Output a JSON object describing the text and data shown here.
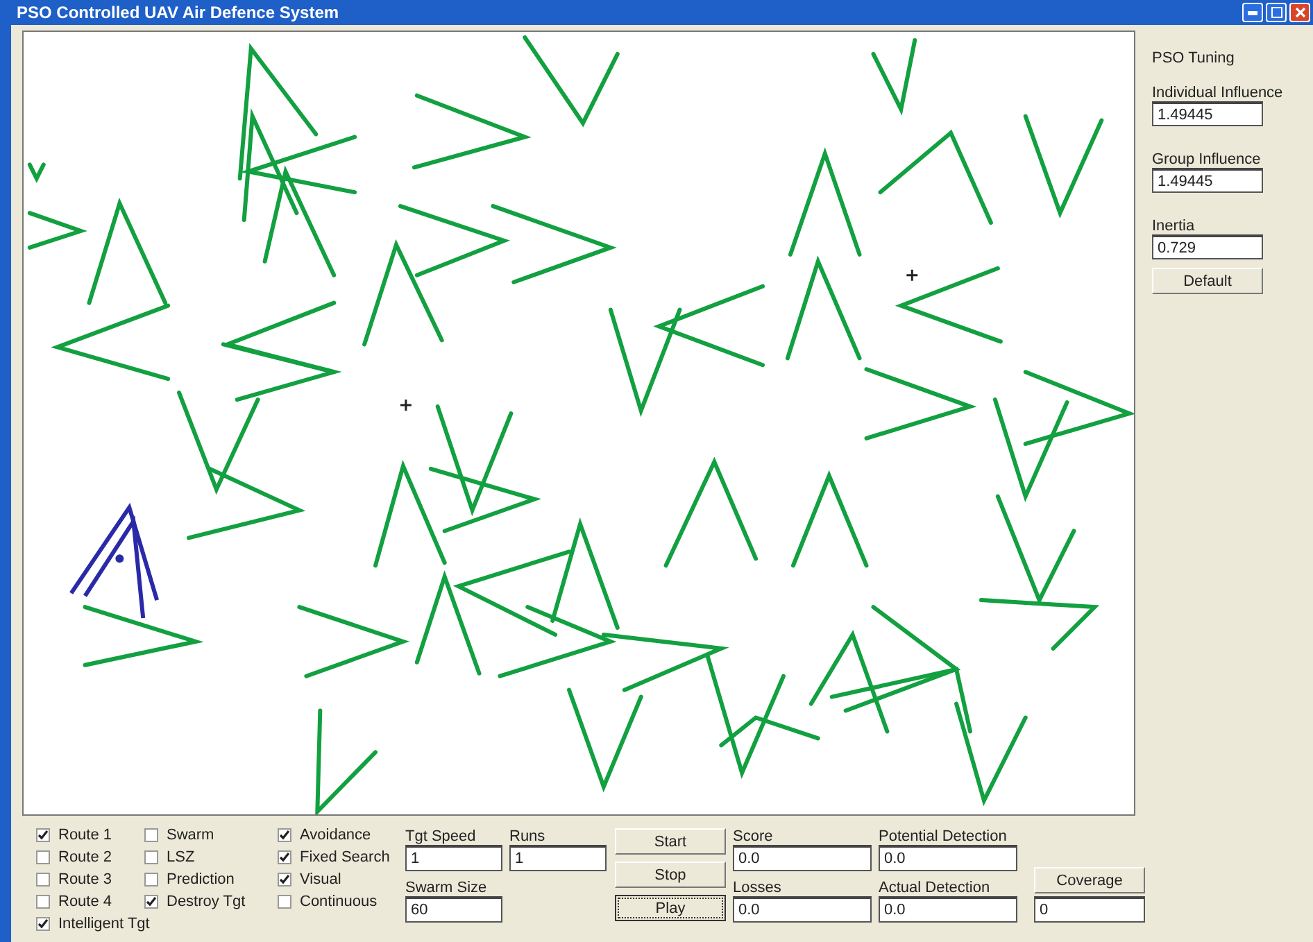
{
  "window": {
    "title": "PSO Controlled UAV Air Defence System"
  },
  "checkbox_columns": [
    [
      {
        "label": "Route 1",
        "checked": true
      },
      {
        "label": "Route 2",
        "checked": false
      },
      {
        "label": "Route 3",
        "checked": false
      },
      {
        "label": "Route 4",
        "checked": false
      },
      {
        "label": "Intelligent Tgt",
        "checked": true
      }
    ],
    [
      {
        "label": "Swarm",
        "checked": false
      },
      {
        "label": "LSZ",
        "checked": false
      },
      {
        "label": "Prediction",
        "checked": false
      },
      {
        "label": "Destroy Tgt",
        "checked": true
      }
    ],
    [
      {
        "label": "Avoidance",
        "checked": true
      },
      {
        "label": "Fixed Search",
        "checked": true
      },
      {
        "label": "Visual",
        "checked": true
      },
      {
        "label": "Continuous",
        "checked": false
      }
    ]
  ],
  "settings": [
    {
      "label": "Tgt Speed",
      "value": "1"
    },
    {
      "label": "Runs",
      "value": "1"
    },
    {
      "label": "Swarm Size",
      "value": "60"
    }
  ],
  "buttons": [
    {
      "label": "Start",
      "focused": false
    },
    {
      "label": "Stop",
      "focused": false
    },
    {
      "label": "Play",
      "focused": true
    }
  ],
  "readouts": [
    {
      "label": "Score",
      "value": "0.0"
    },
    {
      "label": "Potential Detection",
      "value": "0.0"
    },
    {
      "label": "Losses",
      "value": "0.0"
    },
    {
      "label": "Actual Detection",
      "value": "0.0"
    }
  ],
  "coverage": {
    "button": "Coverage",
    "value": "0"
  },
  "tuning": {
    "title": "PSO Tuning",
    "fields": [
      {
        "label": "Individual Influence",
        "value": "1.49445"
      },
      {
        "label": "Group Influence",
        "value": "1.49445"
      },
      {
        "label": "Inertia",
        "value": "0.729"
      }
    ],
    "button": "Default"
  }
}
